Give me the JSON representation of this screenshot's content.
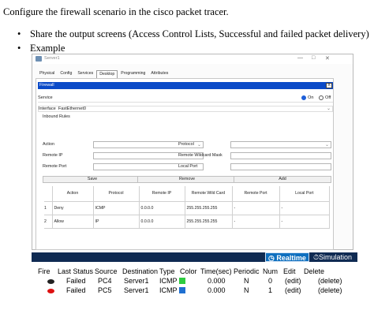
{
  "question": "Configure the firewall scenario in the cisco packet tracer.",
  "bullets": [
    "Share the output screens (Access Control Lists, Successful and failed packet delivery)",
    "Example"
  ],
  "window": {
    "title": "Server1",
    "controls": {
      "minimize": "—",
      "maximize": "□",
      "close": "✕"
    },
    "tabs": [
      "Physical",
      "Config",
      "Services",
      "Desktop",
      "Programming",
      "Attributes"
    ],
    "active_tab": "Desktop"
  },
  "firewall": {
    "header": "Firewall",
    "close": "X",
    "service_label": "Service",
    "on_label": "On",
    "off_label": "Off",
    "interface_label": "Interface",
    "interface_value": "FastEthernet0",
    "inbound_rules": "Inbound Rules",
    "fields": {
      "action": "Action",
      "remote_ip": "Remote IP",
      "remote_port": "Remote Port",
      "protocol": "Protocol",
      "remote_wildcard": "Remote Wildcard Mask",
      "local_port": "Local Port"
    },
    "buttons": {
      "save": "Save",
      "remove": "Remove",
      "add": "Add"
    },
    "table": {
      "headers": [
        "Action",
        "Protocol",
        "Remote IP",
        "Remote Wild Card",
        "Remote Port",
        "Local Port"
      ],
      "rows": [
        {
          "num": "1",
          "action": "Deny",
          "protocol": "ICMP",
          "remote_ip": "0.0.0.0",
          "wildcard": "255.255.255.255",
          "remote_port": "-",
          "local_port": "-"
        },
        {
          "num": "2",
          "action": "Allow",
          "protocol": "IP",
          "remote_ip": "0.0.0.0",
          "wildcard": "255.255.255.255",
          "remote_port": "-",
          "local_port": "-"
        }
      ]
    }
  },
  "simulation": {
    "realtime_label": "Realtime",
    "simulation_label": "Simulation",
    "headers": [
      "Fire",
      "Last Status",
      "Source",
      "Destination",
      "Type",
      "Color",
      "Time(sec)",
      "Periodic",
      "Num",
      "Edit",
      "Delete"
    ],
    "rows": [
      {
        "status": "Failed",
        "source": "PC4",
        "destination": "Server1",
        "type": "ICMP",
        "color": "#2ecc40",
        "time": "0.000",
        "periodic": "N",
        "num": "0",
        "edit": "(edit)",
        "delete": "(delete)"
      },
      {
        "status": "Failed",
        "source": "PC5",
        "destination": "Server1",
        "type": "ICMP",
        "color": "#1f6fd1",
        "time": "0.000",
        "periodic": "N",
        "num": "1",
        "edit": "(edit)",
        "delete": "(delete)"
      }
    ]
  },
  "colors": {
    "firewall_header": "#0a4ac8",
    "sim_bar": "#0f2a52",
    "realtime": "#0e6fbf"
  }
}
